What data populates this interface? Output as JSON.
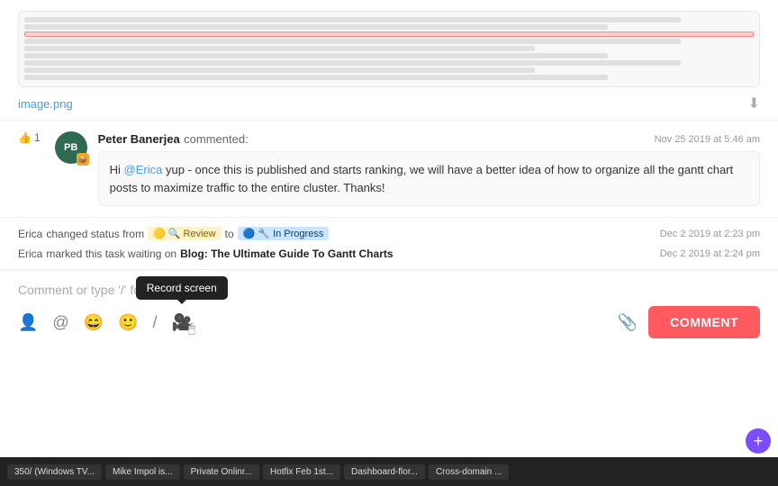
{
  "image": {
    "filename": "image.png",
    "download_label": "⬇"
  },
  "comment": {
    "author": "Peter Banerjea",
    "action": "commented:",
    "timestamp": "Nov 25 2019 at 5:46 am",
    "avatar_initials": "PB",
    "avatar_badge": "📦",
    "like_count": "1",
    "mention": "@Erica",
    "text_before": "Hi ",
    "text_after": " yup - once this is published and starts ranking, we will have a better idea of how to organize all the gantt chart posts to maximize traffic to the entire cluster. Thanks!"
  },
  "activity": {
    "row1": {
      "actor": "Erica",
      "action": "changed status from",
      "from_status": "Review",
      "to_word": "to",
      "to_status": "In Progress",
      "timestamp": "Dec 2 2019 at 2:23 pm"
    },
    "row2": {
      "actor": "Erica",
      "action": "marked this task waiting on",
      "link_text": "Blog: The Ultimate Guide To Gantt Charts",
      "timestamp": "Dec 2 2019 at 2:24 pm"
    }
  },
  "input": {
    "placeholder": "Comment or type '/' for commands",
    "record_tooltip": "Record screen",
    "comment_button": "COMMENT"
  },
  "taskbar": {
    "items": [
      "350/ (Windows TV...",
      "Mike Impol is...",
      "Private Onlinr...",
      "Hotfix Feb 1st...",
      "Dashboard-flor...",
      "Cross-domain ..."
    ]
  }
}
